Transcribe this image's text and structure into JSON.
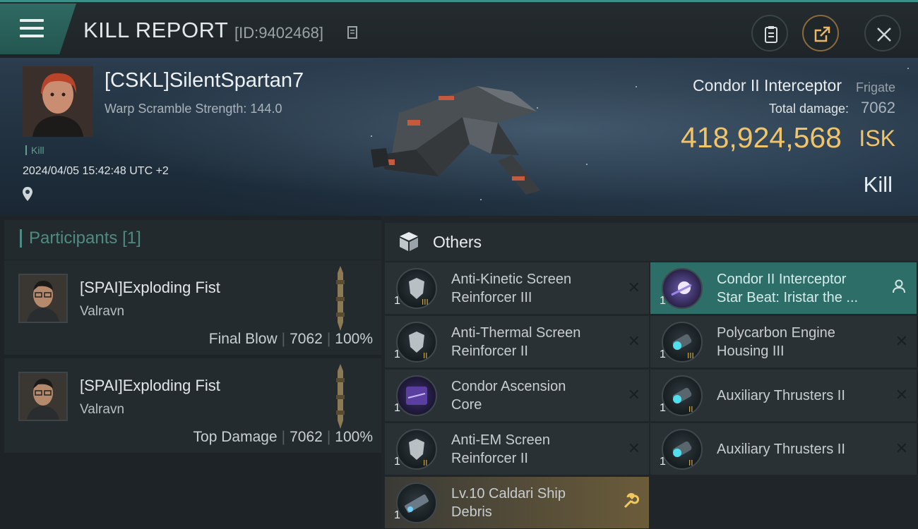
{
  "header": {
    "title": "KILL REPORT",
    "report_id": "[ID:9402468]"
  },
  "victim": {
    "name": "[CSKL]SilentSpartan7",
    "warp_scramble": "Warp Scramble Strength: 144.0",
    "tag": "Kill",
    "timestamp": "2024/04/05 15:42:48 UTC +2",
    "ship_name": "Condor II Interceptor",
    "ship_class": "Frigate",
    "total_damage_label": "Total damage:",
    "total_damage": "7062",
    "isk_value": "418,924,568",
    "isk_unit": "ISK",
    "result": "Kill"
  },
  "participants": {
    "title": "Participants",
    "count": "[1]",
    "rows": [
      {
        "name": "[SPAI]Exploding Fist",
        "ship": "Valravn",
        "role": "Final Blow",
        "damage": "7062",
        "percent": "100%"
      },
      {
        "name": "[SPAI]Exploding Fist",
        "ship": "Valravn",
        "role": "Top Damage",
        "damage": "7062",
        "percent": "100%"
      }
    ]
  },
  "others": {
    "title": "Others",
    "left": [
      {
        "qty": "1",
        "line1": "Anti-Kinetic Screen",
        "line2": "Reinforcer III",
        "status": "destroyed",
        "icon": "shield-module-icon"
      },
      {
        "qty": "1",
        "line1": "Anti-Thermal Screen",
        "line2": "Reinforcer II",
        "status": "destroyed",
        "icon": "shield-module-icon"
      },
      {
        "qty": "1",
        "line1": "Condor Ascension",
        "line2": "Core",
        "status": "destroyed",
        "icon": "core-icon"
      },
      {
        "qty": "1",
        "line1": "Anti-EM Screen",
        "line2": "Reinforcer II",
        "status": "destroyed",
        "icon": "shield-module-icon"
      },
      {
        "qty": "1",
        "line1": "Lv.10 Caldari Ship",
        "line2": "Debris",
        "status": "dropped",
        "icon": "debris-icon"
      }
    ],
    "right": [
      {
        "qty": "1",
        "line1": "Condor II Interceptor",
        "line2": "Star Beat: Iristar the ...",
        "status": "owner",
        "icon": "ship-skin-icon"
      },
      {
        "qty": "1",
        "line1": "Polycarbon Engine",
        "line2": "Housing III",
        "status": "destroyed",
        "icon": "engine-module-icon"
      },
      {
        "qty": "1",
        "line1": "Auxiliary Thrusters II",
        "line2": "",
        "status": "destroyed",
        "icon": "thruster-module-icon"
      },
      {
        "qty": "1",
        "line1": "Auxiliary Thrusters II",
        "line2": "",
        "status": "destroyed",
        "icon": "thruster-module-icon"
      }
    ]
  },
  "colors": {
    "accent": "#3a8f86",
    "isk": "#f2c46a",
    "selected_row": "#2d6e68"
  }
}
